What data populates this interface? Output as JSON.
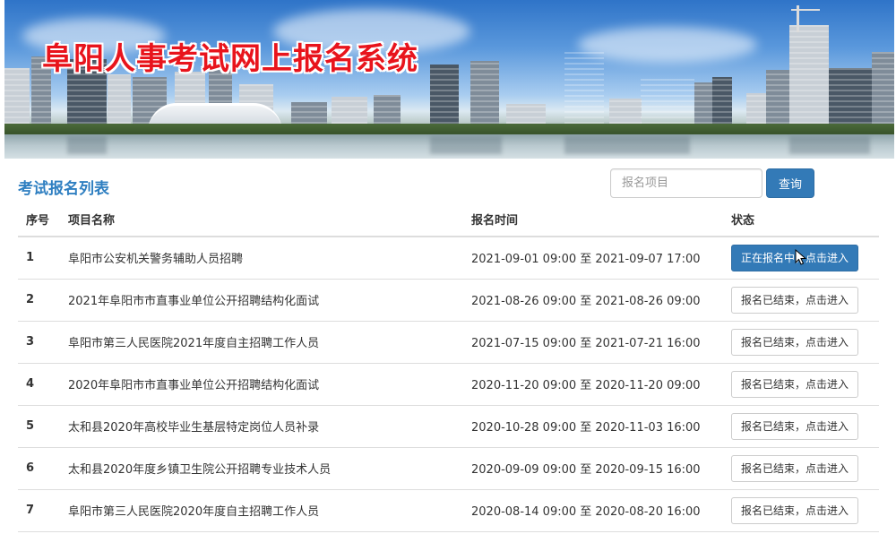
{
  "header": {
    "site_title": "阜阳人事考试网上报名系统"
  },
  "main": {
    "list_heading": "考试报名列表",
    "search": {
      "placeholder": "报名项目",
      "button_label": "查询"
    },
    "table": {
      "columns": [
        "序号",
        "项目名称",
        "报名时间",
        "状态"
      ],
      "rows": [
        {
          "no": "1",
          "name": "阜阳市公安机关警务辅助人员招聘",
          "time": "2021-09-01 09:00 至 2021-09-07 17:00",
          "status": "正在报名中，点击进入",
          "active": true
        },
        {
          "no": "2",
          "name": "2021年阜阳市市直事业单位公开招聘结构化面试",
          "time": "2021-08-26 09:00 至 2021-08-26 09:00",
          "status": "报名已结束，点击进入",
          "active": false
        },
        {
          "no": "3",
          "name": "阜阳市第三人民医院2021年度自主招聘工作人员",
          "time": "2021-07-15 09:00 至 2021-07-21 16:00",
          "status": "报名已结束，点击进入",
          "active": false
        },
        {
          "no": "4",
          "name": "2020年阜阳市市直事业单位公开招聘结构化面试",
          "time": "2020-11-20 09:00 至 2020-11-20 09:00",
          "status": "报名已结束，点击进入",
          "active": false
        },
        {
          "no": "5",
          "name": "太和县2020年高校毕业生基层特定岗位人员补录",
          "time": "2020-10-28 09:00 至 2020-11-03 16:00",
          "status": "报名已结束，点击进入",
          "active": false
        },
        {
          "no": "6",
          "name": "太和县2020年度乡镇卫生院公开招聘专业技术人员",
          "time": "2020-09-09 09:00 至 2020-09-15 16:00",
          "status": "报名已结束，点击进入",
          "active": false
        },
        {
          "no": "7",
          "name": "阜阳市第三人民医院2020年度自主招聘工作人员",
          "time": "2020-08-14 09:00 至 2020-08-20 16:00",
          "status": "报名已结束，点击进入",
          "active": false
        }
      ]
    }
  },
  "colors": {
    "title_red": "#e8141c",
    "heading_blue": "#2f7fc1",
    "primary_button": "#337ab7"
  },
  "icons": {
    "cursor": "mouse-pointer-icon"
  }
}
